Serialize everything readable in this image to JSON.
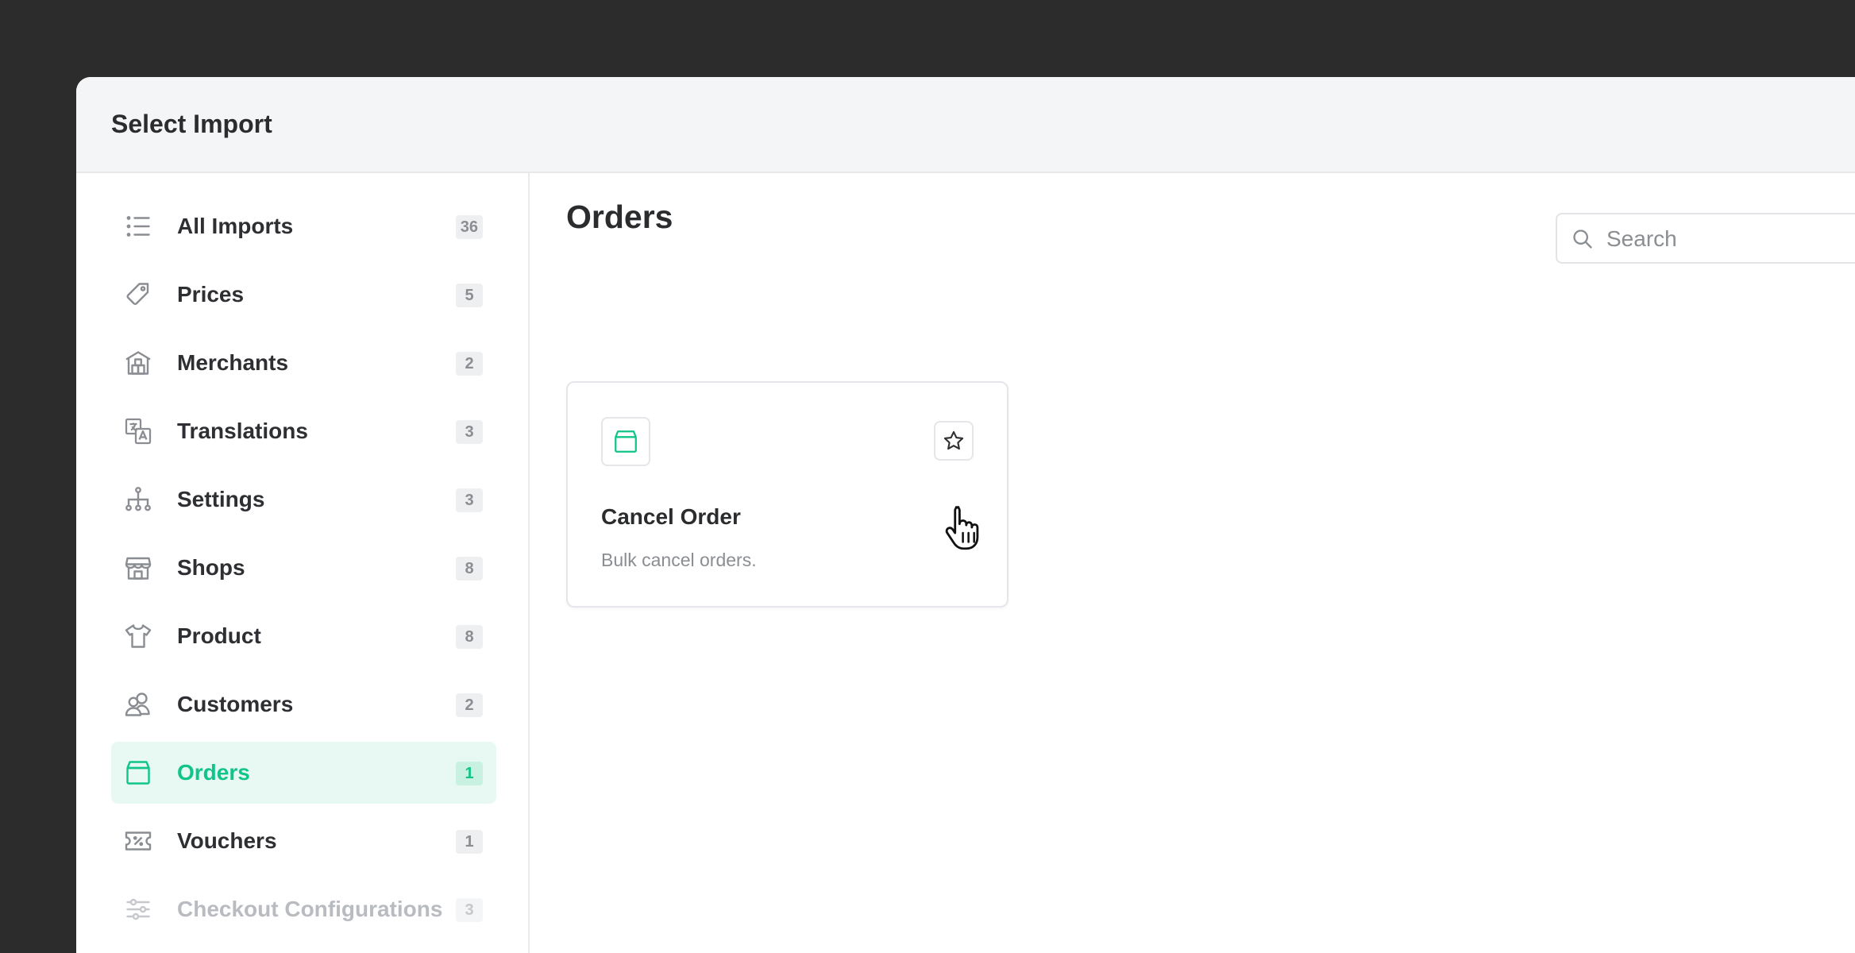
{
  "modal": {
    "title": "Select Import"
  },
  "sidebar": {
    "items": [
      {
        "label": "All Imports",
        "count": "36",
        "icon": "list-icon"
      },
      {
        "label": "Prices",
        "count": "5",
        "icon": "tag-icon"
      },
      {
        "label": "Merchants",
        "count": "2",
        "icon": "warehouse-icon"
      },
      {
        "label": "Translations",
        "count": "3",
        "icon": "translate-icon"
      },
      {
        "label": "Settings",
        "count": "3",
        "icon": "hierarchy-icon"
      },
      {
        "label": "Shops",
        "count": "8",
        "icon": "store-icon"
      },
      {
        "label": "Product",
        "count": "8",
        "icon": "shirt-icon"
      },
      {
        "label": "Customers",
        "count": "2",
        "icon": "users-icon"
      },
      {
        "label": "Orders",
        "count": "1",
        "icon": "package-icon",
        "active": true
      },
      {
        "label": "Vouchers",
        "count": "1",
        "icon": "voucher-icon"
      },
      {
        "label": "Checkout Configurations",
        "count": "3",
        "icon": "sliders-icon"
      }
    ]
  },
  "main": {
    "title": "Orders",
    "search": {
      "placeholder": "Search",
      "value": ""
    },
    "cards": [
      {
        "title": "Cancel Order",
        "description": "Bulk cancel orders.",
        "icon": "package-icon",
        "favorite": false
      }
    ]
  },
  "colors": {
    "accent": "#10c48a",
    "accent_bg": "#e7f9f2",
    "backdrop": "#2c2c2c"
  }
}
